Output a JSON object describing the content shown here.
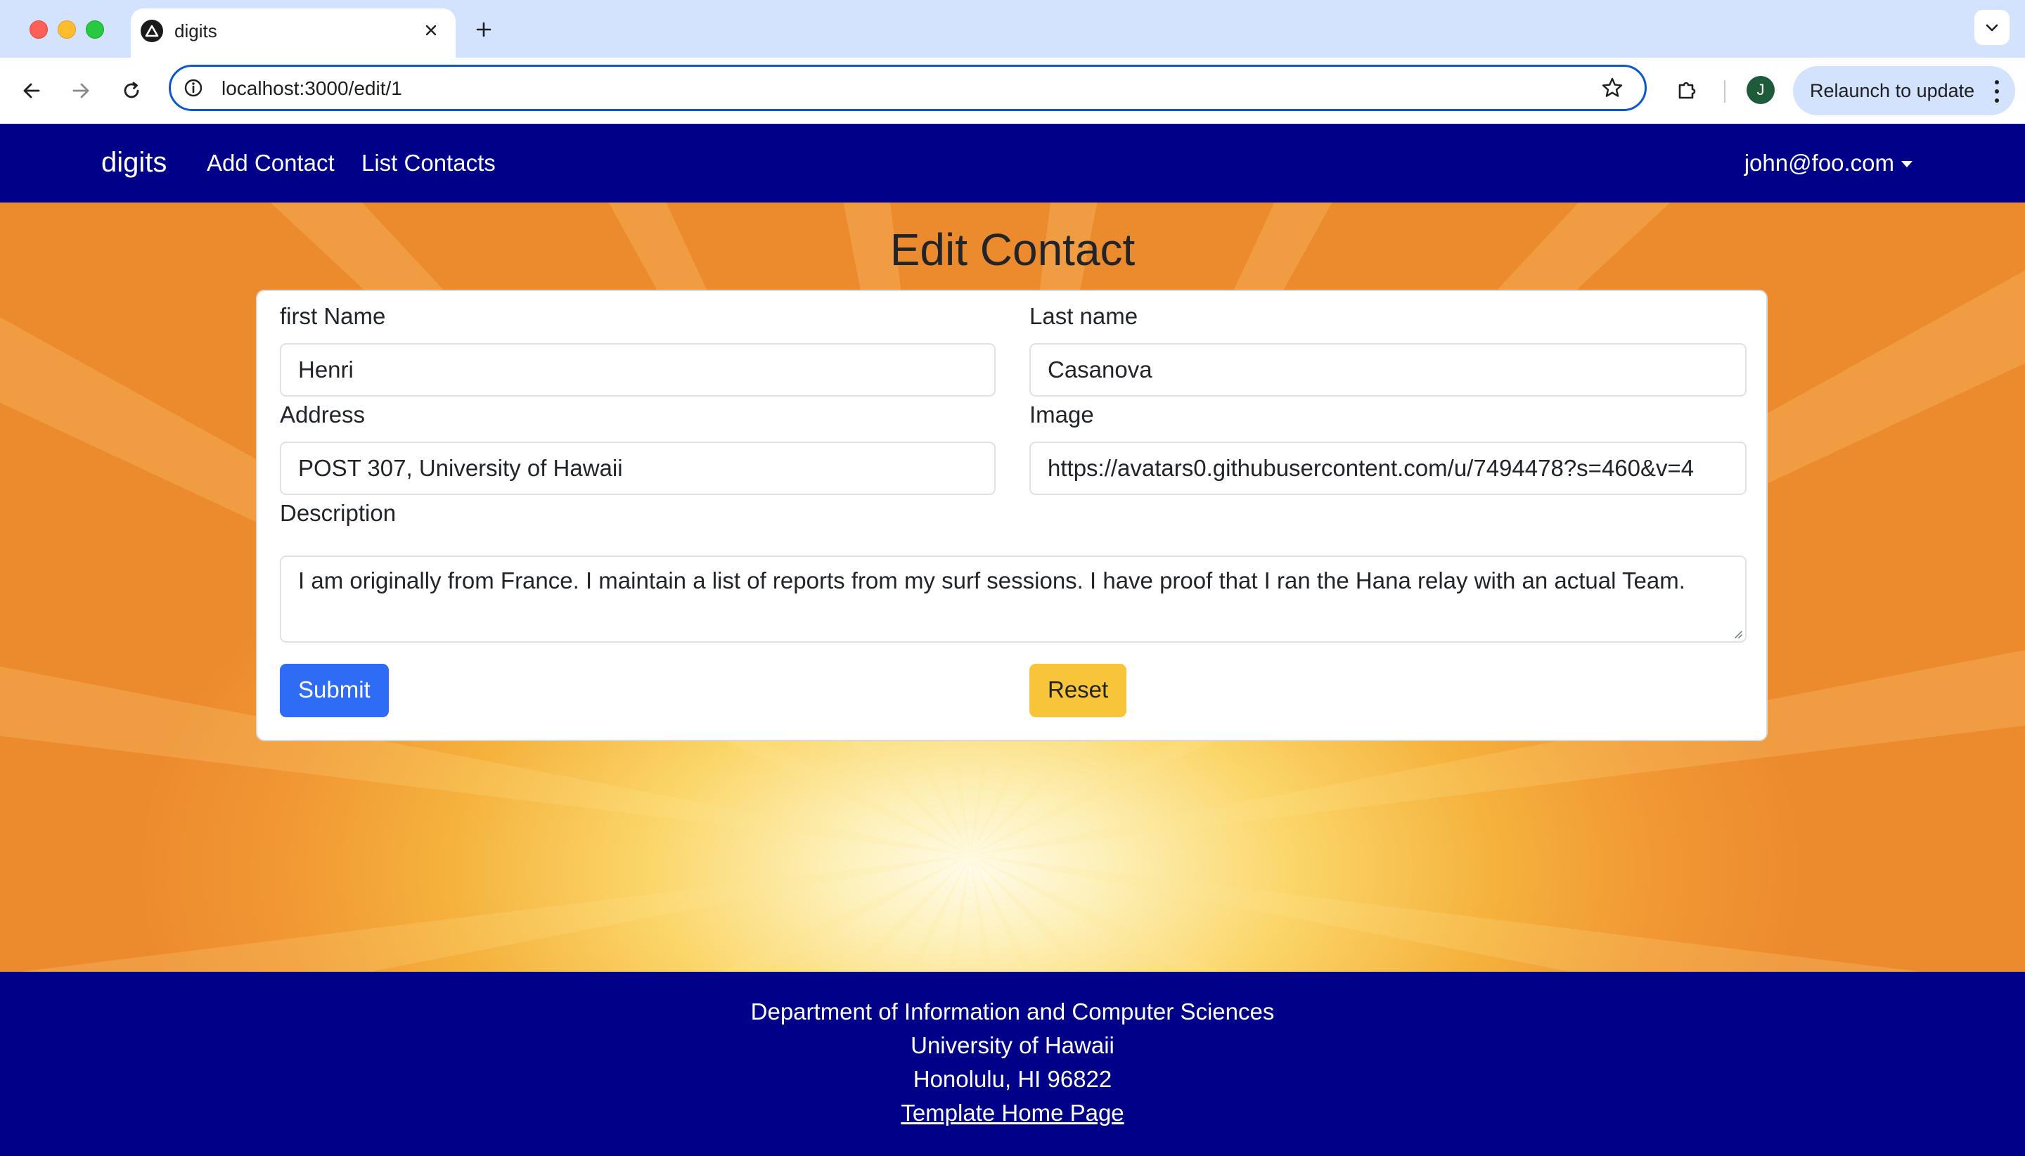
{
  "browser": {
    "tab_title": "digits",
    "url": "localhost:3000/edit/1",
    "profile_initial": "J",
    "relaunch_label": "Relaunch to update",
    "icons": [
      "close-icon",
      "plus-icon",
      "chevron-down-icon",
      "back-arrow-icon",
      "forward-arrow-icon",
      "reload-icon",
      "info-icon",
      "star-icon",
      "puzzle-icon",
      "more-vert-icon"
    ]
  },
  "navbar": {
    "brand": "digits",
    "links": [
      "Add Contact",
      "List Contacts"
    ],
    "user": "john@foo.com",
    "color": "#000088"
  },
  "page": {
    "title": "Edit Contact"
  },
  "form": {
    "first_name_label": "first Name",
    "first_name_value": "Henri",
    "last_name_label": "Last name",
    "last_name_value": "Casanova",
    "address_label": "Address",
    "address_value": "POST 307, University of Hawaii",
    "image_label": "Image",
    "image_value": "https://avatars0.githubusercontent.com/u/7494478?s=460&v=4",
    "description_label": "Description",
    "description_value": "I am originally from France. I maintain a list of reports from my surf sessions. I have proof that I ran the Hana relay with an actual Team.",
    "submit_label": "Submit",
    "reset_label": "Reset",
    "submit_color": "#2f6cf6",
    "reset_color": "#f8c53a"
  },
  "footer": {
    "lines": [
      "Department of Information and Computer Sciences",
      "University of Hawaii",
      "Honolulu, HI 96822"
    ],
    "link": "Template Home Page"
  }
}
